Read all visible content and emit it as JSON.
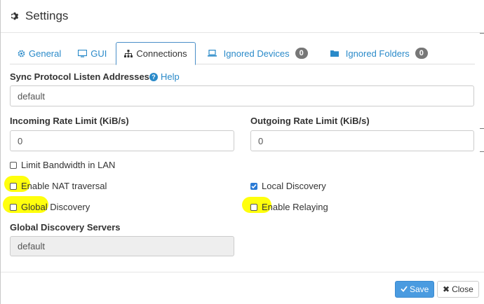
{
  "header": {
    "title": "Settings",
    "icon": "gear-icon"
  },
  "tabs": [
    {
      "label": "General",
      "icon": "gear-icon"
    },
    {
      "label": "GUI",
      "icon": "monitor-icon"
    },
    {
      "label": "Connections",
      "icon": "sitemap-icon",
      "active": true
    },
    {
      "label": "Ignored Devices",
      "icon": "laptop-icon",
      "badge": "0"
    },
    {
      "label": "Ignored Folders",
      "icon": "folder-icon",
      "badge": "0"
    }
  ],
  "form": {
    "listen_label": "Sync Protocol Listen Addresses",
    "help_label": "Help",
    "listen_value": "default",
    "incoming_label": "Incoming Rate Limit (KiB/s)",
    "incoming_value": "0",
    "outgoing_label": "Outgoing Rate Limit (KiB/s)",
    "outgoing_value": "0",
    "limit_lan_label": "Limit Bandwidth in LAN",
    "nat_label": "Enable NAT traversal",
    "local_discovery_label": "Local Discovery",
    "global_discovery_label": "Global Discovery",
    "relaying_label": "Enable Relaying",
    "gds_label": "Global Discovery Servers",
    "gds_value": "default"
  },
  "checkboxes": {
    "limit_lan": false,
    "nat": false,
    "local_discovery": true,
    "global_discovery": false,
    "relaying": false
  },
  "footer": {
    "save_label": "Save",
    "close_label": "Close"
  },
  "colors": {
    "accent": "#2a8ac9",
    "highlight": "#ffff00",
    "save": "#4a9be0"
  }
}
